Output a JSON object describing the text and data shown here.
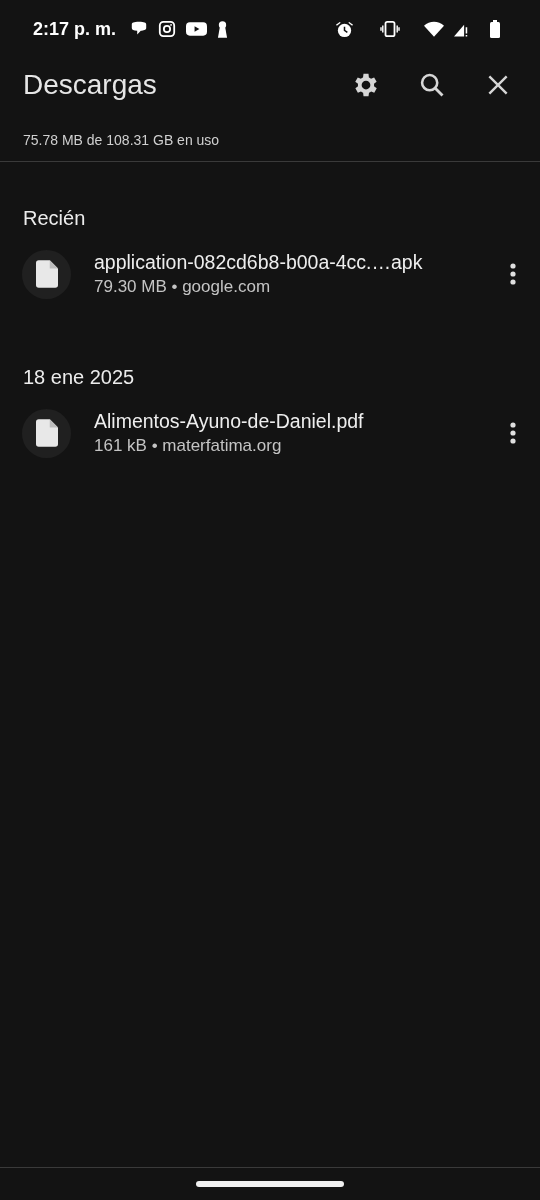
{
  "status_bar": {
    "time": "2:17 p. m."
  },
  "header": {
    "title": "Descargas",
    "storage": "75.78 MB de 108.31 GB en uso"
  },
  "sections": [
    {
      "heading": "Recién",
      "items": [
        {
          "name": "application-082cd6b8-b00a-4cc.…apk",
          "meta": "79.30 MB • google.com"
        }
      ]
    },
    {
      "heading": "18 ene 2025",
      "items": [
        {
          "name": "Alimentos-Ayuno-de-Daniel.pdf",
          "meta": "161 kB • materfatima.org"
        }
      ]
    }
  ]
}
